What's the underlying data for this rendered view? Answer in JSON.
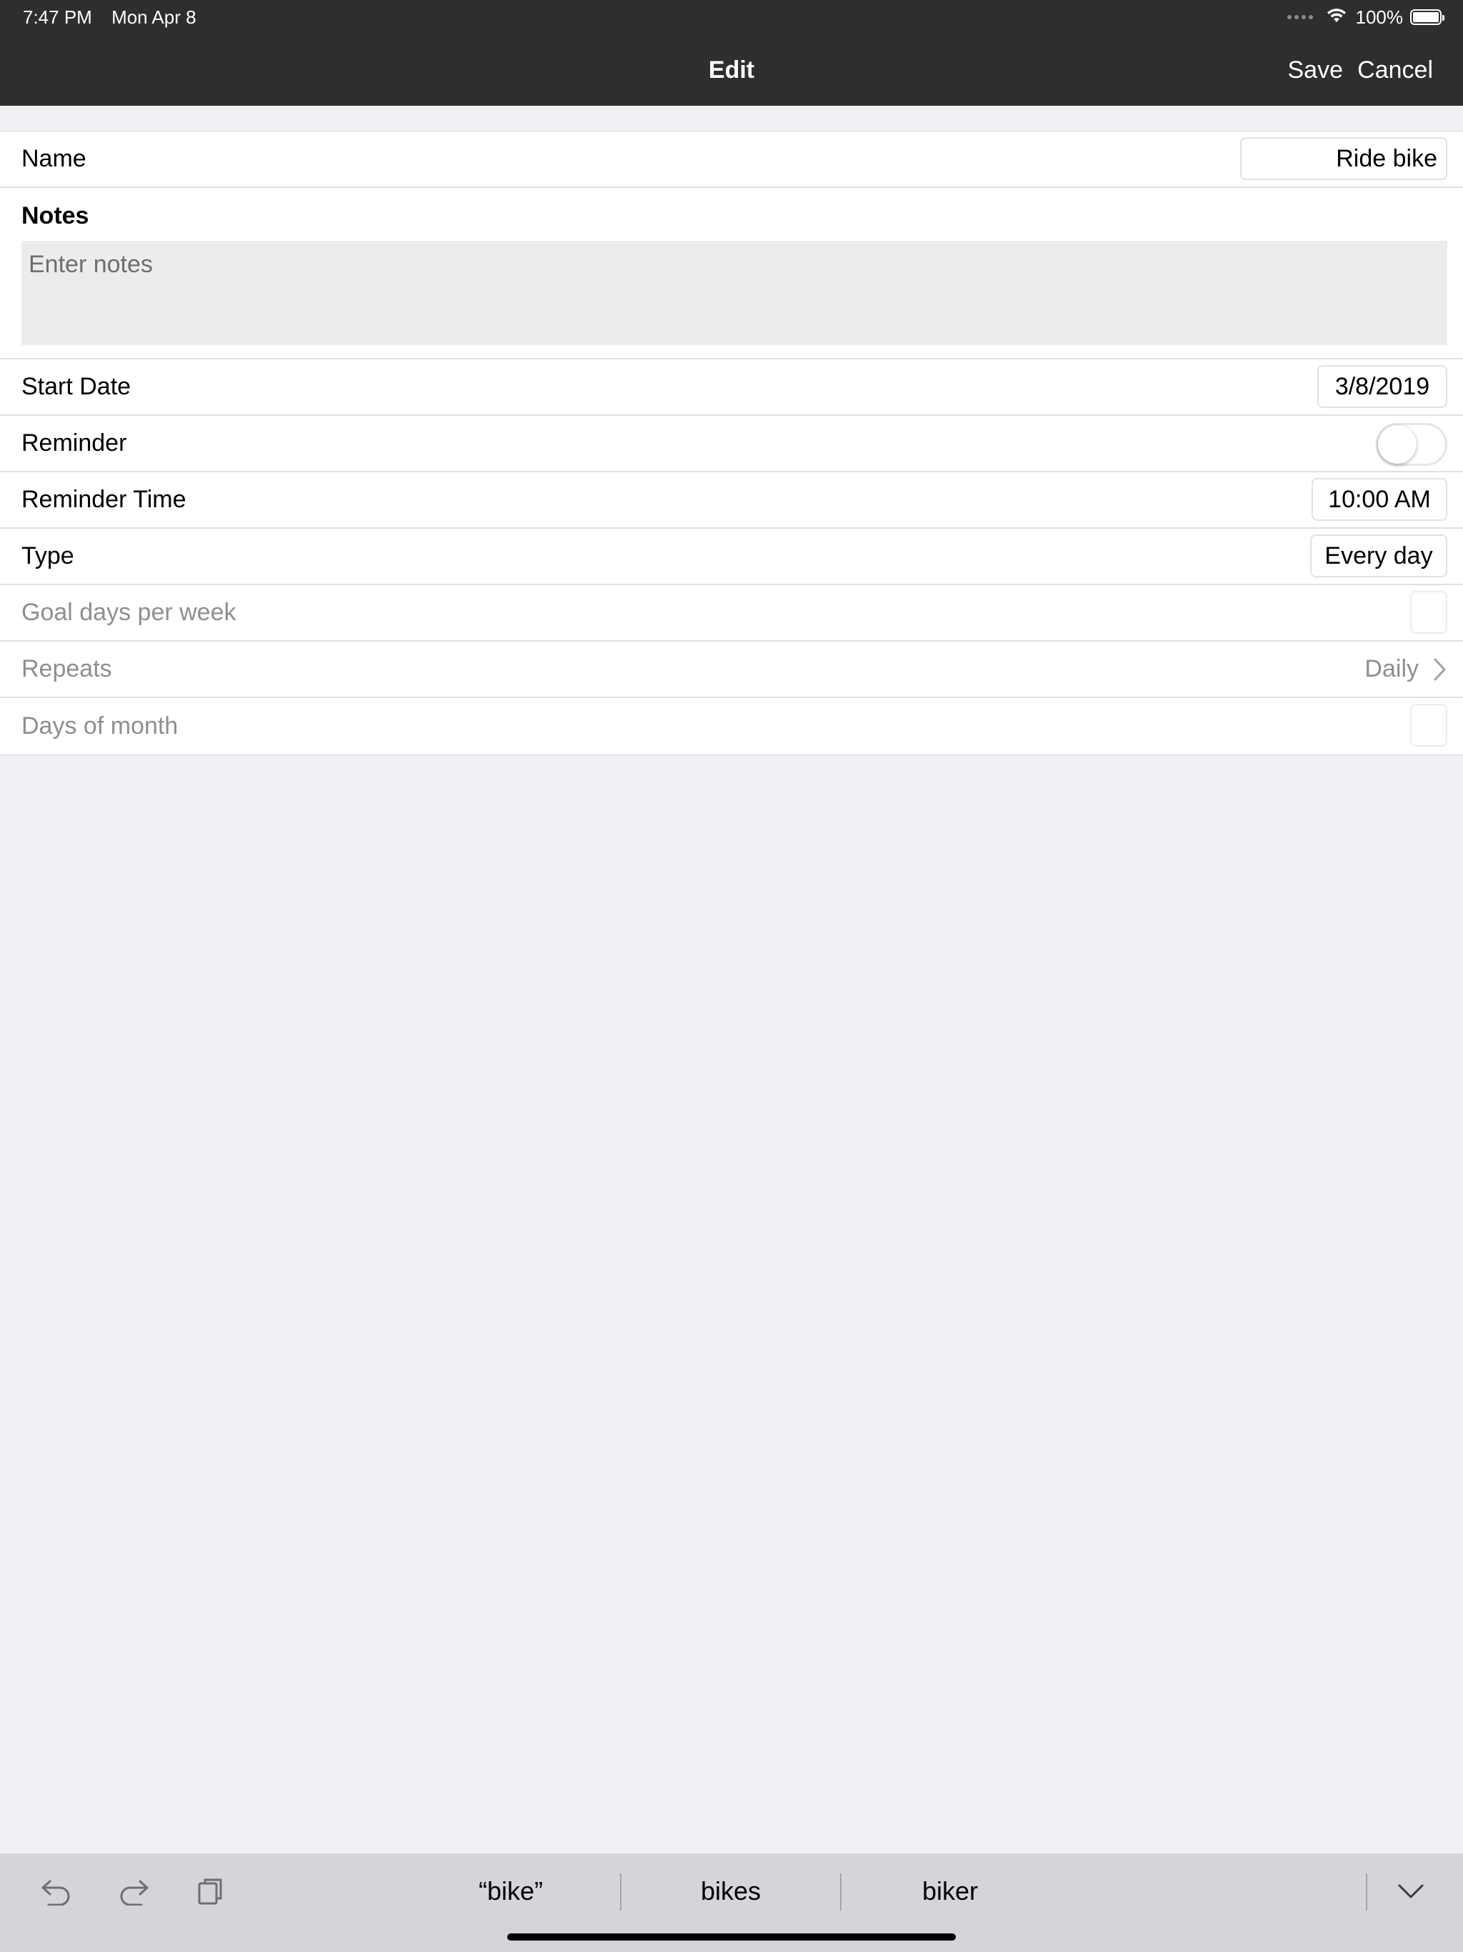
{
  "status_bar": {
    "time": "7:47 PM",
    "date": "Mon Apr 8",
    "battery_percent": "100%"
  },
  "nav": {
    "title": "Edit",
    "save_label": "Save",
    "cancel_label": "Cancel"
  },
  "form": {
    "name": {
      "label": "Name",
      "value": "Ride bike"
    },
    "notes": {
      "label": "Notes",
      "placeholder": "Enter notes"
    },
    "start_date": {
      "label": "Start Date",
      "value": "3/8/2019"
    },
    "reminder": {
      "label": "Reminder",
      "on": false
    },
    "reminder_time": {
      "label": "Reminder Time",
      "value": "10:00 AM"
    },
    "type": {
      "label": "Type",
      "value": "Every day"
    },
    "goal_days": {
      "label": "Goal days per week"
    },
    "repeats": {
      "label": "Repeats",
      "value": "Daily"
    },
    "days_of_month": {
      "label": "Days of month"
    }
  },
  "keyboard_bar": {
    "suggestions": [
      "“bike”",
      "bikes",
      "biker"
    ],
    "icons": [
      "undo-icon",
      "redo-icon",
      "paste-icon",
      "keyboard-dismiss-icon"
    ]
  },
  "colors": {
    "nav_background": "#2e2e2e",
    "page_background": "#efeff4",
    "muted_text": "#8e8e93",
    "keyboard_bar": "#d4d5da"
  }
}
